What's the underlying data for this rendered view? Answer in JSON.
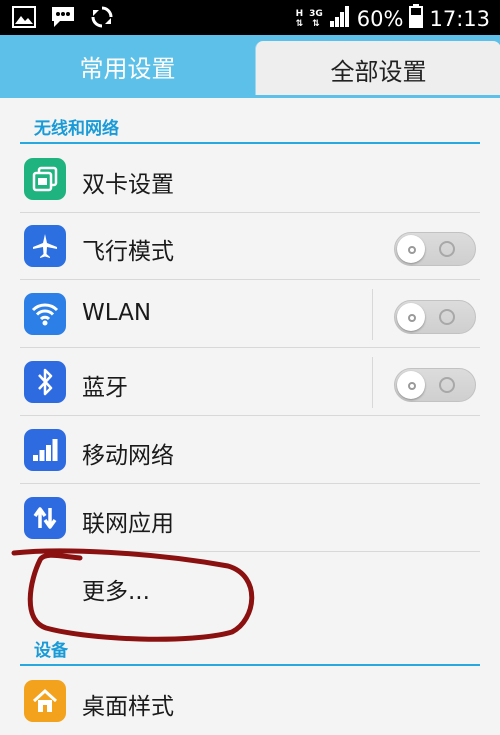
{
  "status_bar": {
    "network_h": "H",
    "network_3g": "3G",
    "battery_percent": "60%",
    "time": "17:13",
    "icons": [
      "image-icon",
      "message-icon",
      "sync-icon",
      "signal-icon",
      "battery-icon"
    ]
  },
  "tabs": [
    {
      "label": "常用设置",
      "active": false
    },
    {
      "label": "全部设置",
      "active": true
    }
  ],
  "sections": [
    {
      "title": "无线和网络"
    },
    {
      "title": "设备"
    }
  ],
  "items": [
    {
      "label": "双卡设置",
      "icon": "dual-sim-icon",
      "color": "#1fb37f"
    },
    {
      "label": "飞行模式",
      "icon": "airplane-icon",
      "color": "#2b6fe0",
      "toggle": "off"
    },
    {
      "label": "WLAN",
      "icon": "wifi-icon",
      "color": "#2b7fe6",
      "toggle": "off"
    },
    {
      "label": "蓝牙",
      "icon": "bluetooth-icon",
      "color": "#2f6be0",
      "toggle": "off"
    },
    {
      "label": "移动网络",
      "icon": "signal-bars-icon",
      "color": "#2f6be0"
    },
    {
      "label": "联网应用",
      "icon": "data-arrows-icon",
      "color": "#2f6be0"
    },
    {
      "label": "更多..."
    },
    {
      "label": "桌面样式",
      "icon": "home-icon",
      "color": "#f2a21c"
    }
  ],
  "colors": {
    "accent": "#29a8e0",
    "tabbar": "#5cc0e8",
    "annotation": "#8b1010"
  }
}
